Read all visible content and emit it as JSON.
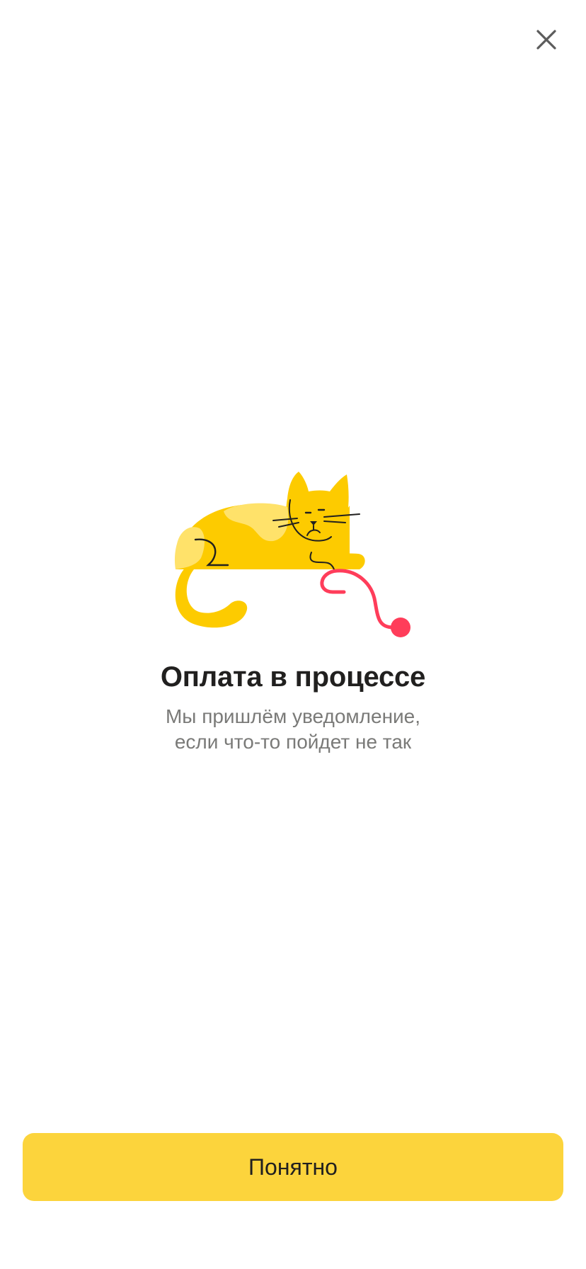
{
  "header": {
    "close_icon": "close-icon"
  },
  "illustration": {
    "icon": "cat-with-yarn-illustration",
    "colors": {
      "body": "#fdcb00",
      "spots": "#ffe26a",
      "line": "#21201f",
      "yarn": "#ff3d5a"
    }
  },
  "main": {
    "title": "Оплата в процессе",
    "subtitle_line1": "Мы пришлём уведомление,",
    "subtitle_line2": "если что-то пойдет не так"
  },
  "footer": {
    "ok_label": "Понятно",
    "accent_color": "#fcd43c"
  }
}
